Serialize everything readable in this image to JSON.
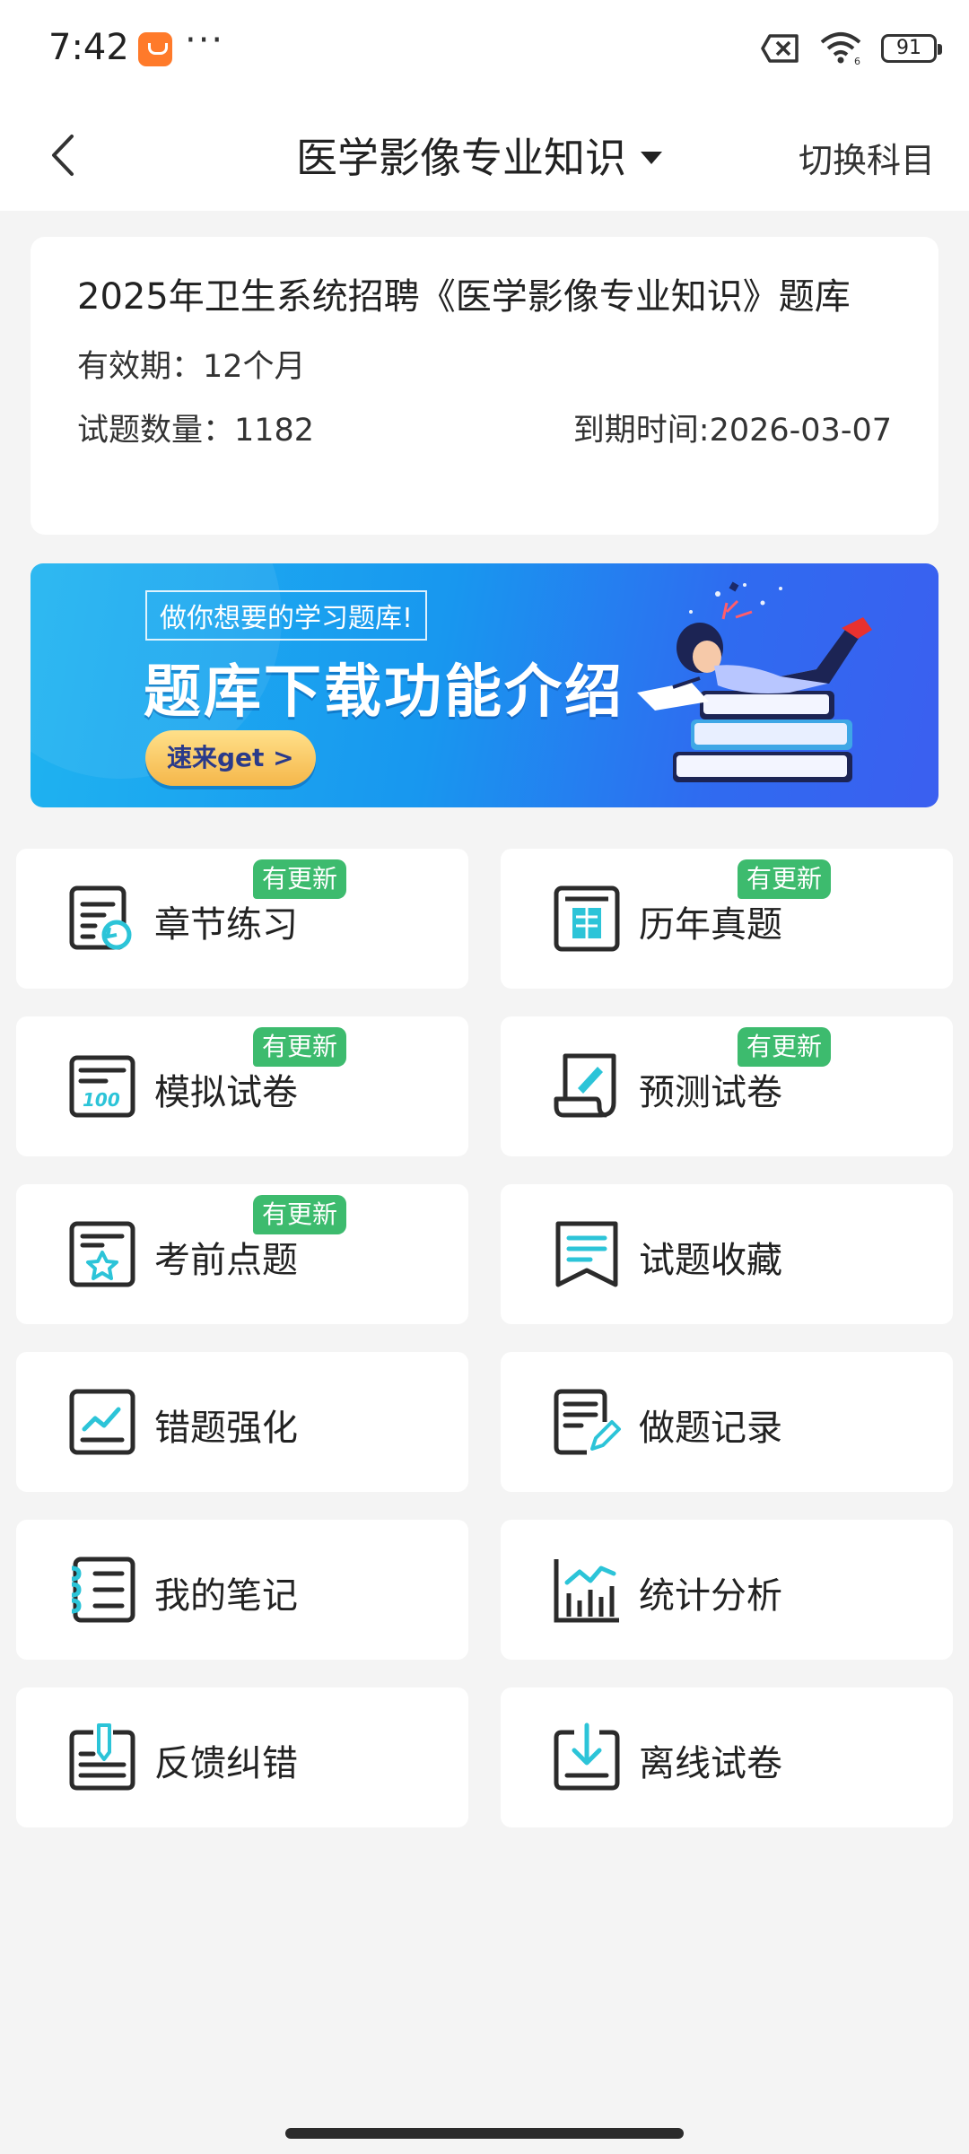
{
  "status_bar": {
    "time": "7:42",
    "dots": "···",
    "battery": "91",
    "icons": [
      "app-notification-icon",
      "no-sim-icon",
      "wifi-icon",
      "battery-icon"
    ]
  },
  "nav": {
    "title": "医学影像专业知识",
    "switch_label": "切换科目"
  },
  "info": {
    "title": "2025年卫生系统招聘《医学影像专业知识》题库",
    "validity": "有效期：12个月",
    "question_count": "试题数量：1182",
    "expiry": "到期时间:2026-03-07"
  },
  "banner": {
    "subtitle": "做你想要的学习题库!",
    "title": "题库下载功能介绍",
    "button": "速来get >"
  },
  "menu": [
    {
      "label": "章节练习",
      "badge": "有更新",
      "icon": "chapter-practice-icon"
    },
    {
      "label": "历年真题",
      "badge": "有更新",
      "icon": "past-exams-icon"
    },
    {
      "label": "模拟试卷",
      "badge": "有更新",
      "icon": "mock-paper-icon"
    },
    {
      "label": "预测试卷",
      "badge": "有更新",
      "icon": "forecast-paper-icon"
    },
    {
      "label": "考前点题",
      "badge": "有更新",
      "icon": "key-points-icon"
    },
    {
      "label": "试题收藏",
      "badge": "",
      "icon": "favorites-icon"
    },
    {
      "label": "错题强化",
      "badge": "",
      "icon": "wrong-questions-icon"
    },
    {
      "label": "做题记录",
      "badge": "",
      "icon": "practice-record-icon"
    },
    {
      "label": "我的笔记",
      "badge": "",
      "icon": "notes-icon"
    },
    {
      "label": "统计分析",
      "badge": "",
      "icon": "statistics-icon"
    },
    {
      "label": "反馈纠错",
      "badge": "",
      "icon": "feedback-icon"
    },
    {
      "label": "离线试卷",
      "badge": "",
      "icon": "offline-download-icon"
    }
  ],
  "colors": {
    "accent": "#2cc4d8",
    "badge": "#3dbb6e",
    "icon_dark": "#2b2b2b"
  }
}
